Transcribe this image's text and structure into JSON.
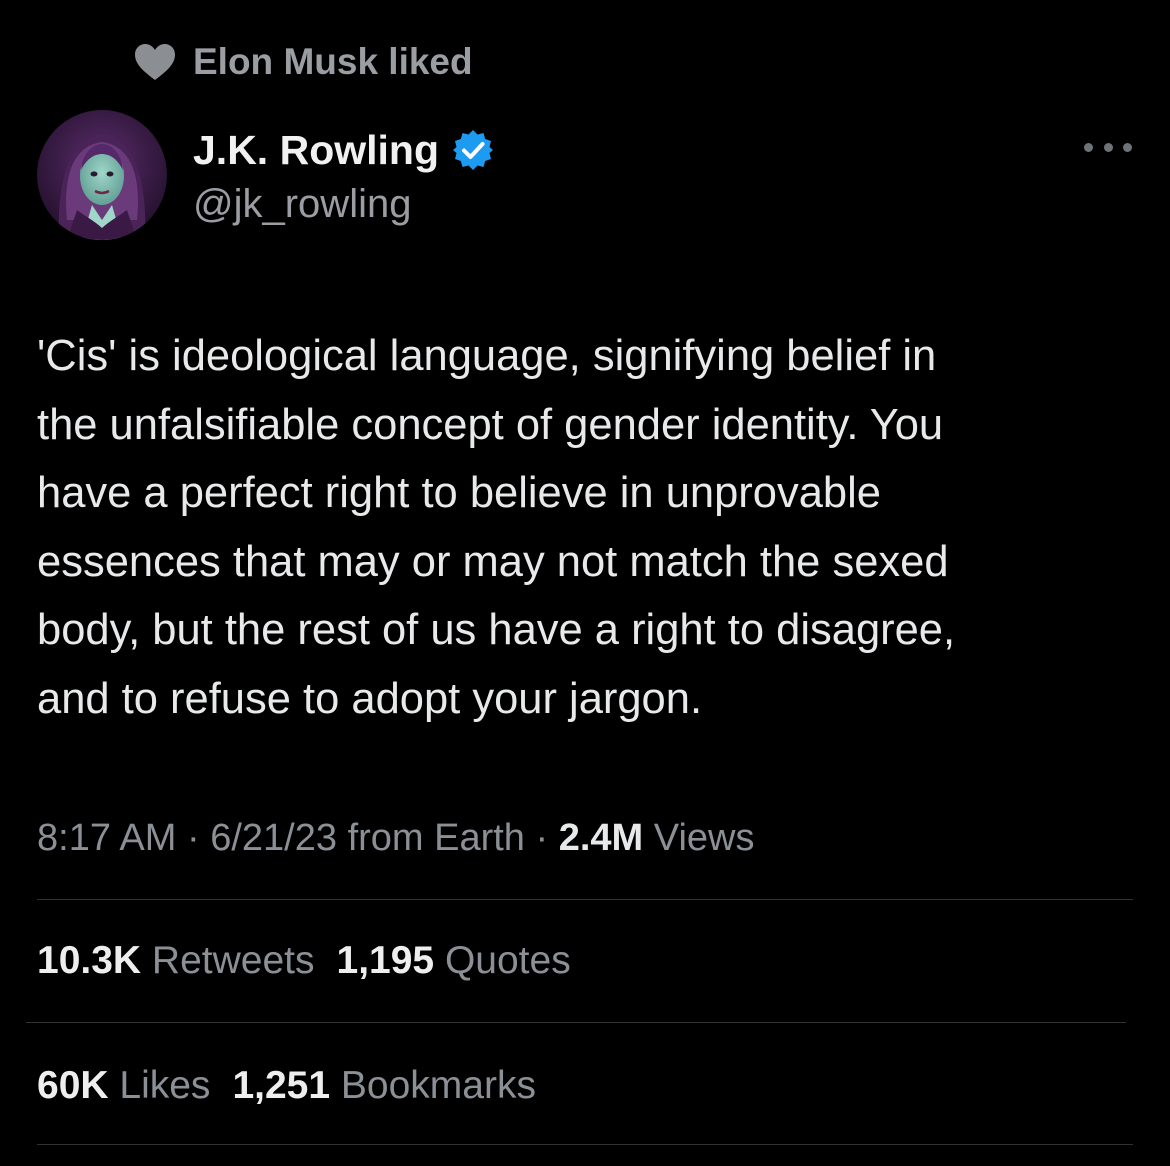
{
  "social_context": {
    "icon": "heart-icon",
    "text": "Elon Musk liked"
  },
  "author": {
    "name": "J.K. Rowling",
    "handle": "@jk_rowling",
    "verified": true,
    "verified_color": "#1d9bf0"
  },
  "tweet": {
    "text": "'Cis' is ideological language, signifying belief in\nthe unfalsifiable concept of gender identity. You\nhave a perfect right to believe in unprovable\nessences that may or may not match the sexed\nbody, but the rest of us have a right to disagree,\nand to refuse to adopt your jargon."
  },
  "meta": {
    "time": "8:17 AM",
    "separator": " · ",
    "date": "6/21/23",
    "source": "from Earth",
    "views_count": "2.4M",
    "views_label": "Views"
  },
  "stats": {
    "retweets": {
      "count": "10.3K",
      "label": "Retweets"
    },
    "quotes": {
      "count": "1,195",
      "label": "Quotes"
    },
    "likes": {
      "count": "60K",
      "label": "Likes"
    },
    "bookmarks": {
      "count": "1,251",
      "label": "Bookmarks"
    }
  },
  "colors": {
    "background": "#000000",
    "text": "#e7e9ea",
    "secondary": "#8b9096",
    "divider": "#2f3336"
  }
}
